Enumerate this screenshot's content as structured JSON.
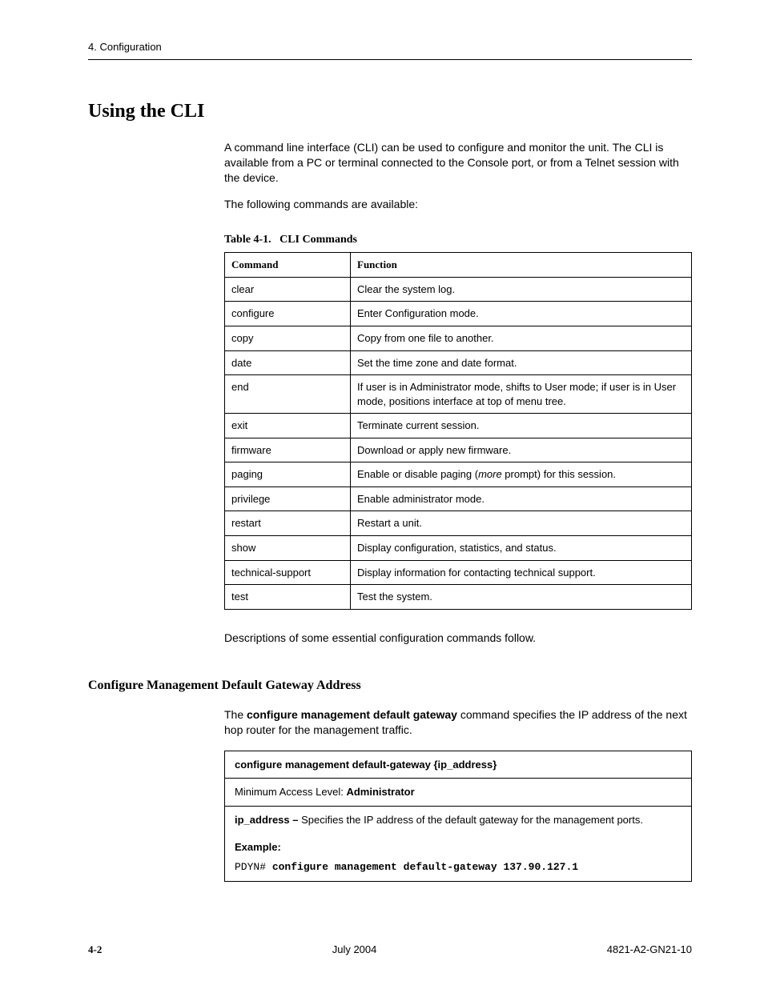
{
  "header": {
    "chapter": "4. Configuration"
  },
  "title": "Using the CLI",
  "intro1": "A command line interface (CLI) can be used to configure and monitor the unit. The CLI is available from a PC or terminal connected to the Console port, or from a Telnet session with the device.",
  "intro2": "The following commands are available:",
  "table_caption_label": "Table 4-1.",
  "table_caption_title": "CLI Commands",
  "table": {
    "head_cmd": "Command",
    "head_fn": "Function",
    "rows": [
      {
        "cmd": "clear",
        "fn": "Clear the system log."
      },
      {
        "cmd": "configure",
        "fn": "Enter Configuration mode."
      },
      {
        "cmd": "copy",
        "fn": "Copy from one file to another."
      },
      {
        "cmd": "date",
        "fn": "Set the time zone and date format."
      },
      {
        "cmd": "end",
        "fn": "If user is in Administrator mode, shifts to User mode; if user is in User mode, positions interface at top of menu tree."
      },
      {
        "cmd": "exit",
        "fn": "Terminate current session."
      },
      {
        "cmd": "firmware",
        "fn": "Download or apply new firmware."
      },
      {
        "cmd": "paging",
        "fn_pre": "Enable or disable paging (",
        "fn_em": "more",
        "fn_post": " prompt) for this session."
      },
      {
        "cmd": "privilege",
        "fn": "Enable administrator mode."
      },
      {
        "cmd": "restart",
        "fn": "Restart a unit."
      },
      {
        "cmd": "show",
        "fn": "Display configuration, statistics, and status."
      },
      {
        "cmd": "technical-support",
        "fn": "Display information for contacting technical support."
      },
      {
        "cmd": "test",
        "fn": "Test the system."
      }
    ]
  },
  "post_table": "Descriptions of some essential configuration commands follow.",
  "subsection_title": "Configure Management Default Gateway Address",
  "sub_p_pre": "The ",
  "sub_p_bold": "configure management default gateway",
  "sub_p_post": " command specifies the IP address of the next hop router for the management traffic.",
  "cmdbox": {
    "syntax": "configure management default-gateway {ip_address}",
    "min_access_label": "Minimum Access Level:  ",
    "min_access_value": "Administrator",
    "param_name": "ip_address – ",
    "param_desc": "Specifies the IP address of the default gateway for the management ports.",
    "example_label": "Example:",
    "prompt": "PDYN# ",
    "example_cmd": "configure management default-gateway 137.90.127.1"
  },
  "footer": {
    "page": "4-2",
    "date": "July 2004",
    "docnum": "4821-A2-GN21-10"
  }
}
